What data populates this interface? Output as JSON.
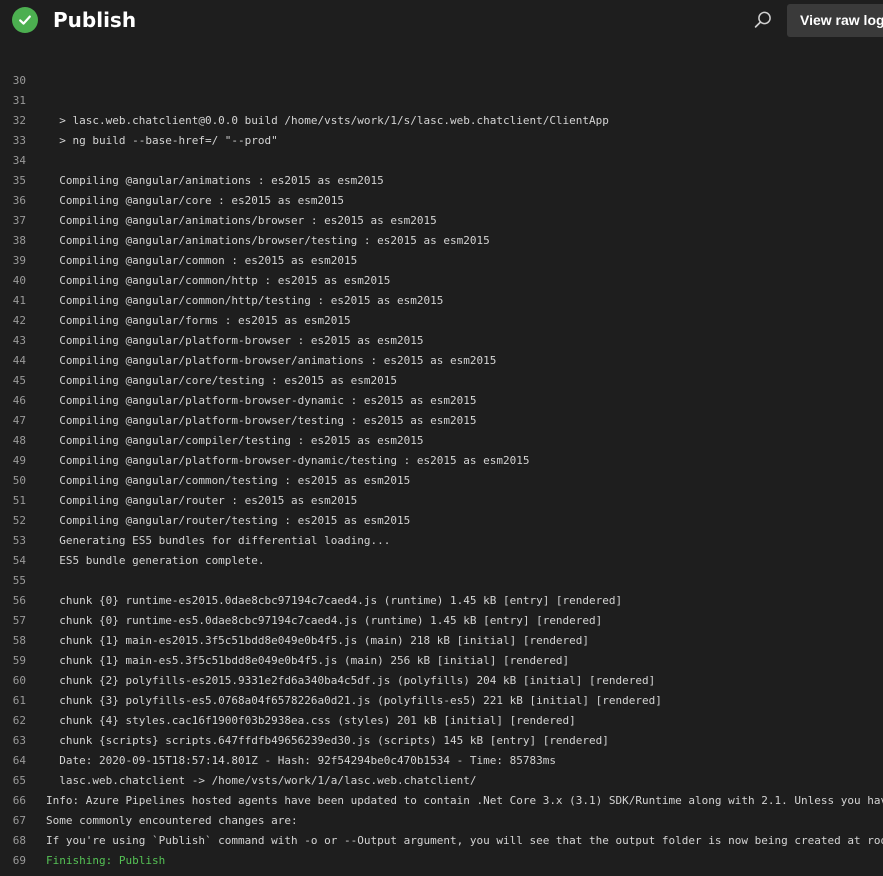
{
  "header": {
    "title": "Publish",
    "status_icon": "success-check-icon",
    "status_color": "#4caf50",
    "search_icon": "search-icon",
    "view_raw_log_label": "View raw log"
  },
  "log": {
    "lines": [
      {
        "number": "30",
        "text": ""
      },
      {
        "number": "31",
        "text": ""
      },
      {
        "number": "32",
        "text": "  > lasc.web.chatclient@0.0.0 build /home/vsts/work/1/s/lasc.web.chatclient/ClientApp"
      },
      {
        "number": "33",
        "text": "  > ng build --base-href=/ \"--prod\""
      },
      {
        "number": "34",
        "text": ""
      },
      {
        "number": "35",
        "text": "  Compiling @angular/animations : es2015 as esm2015"
      },
      {
        "number": "36",
        "text": "  Compiling @angular/core : es2015 as esm2015"
      },
      {
        "number": "37",
        "text": "  Compiling @angular/animations/browser : es2015 as esm2015"
      },
      {
        "number": "38",
        "text": "  Compiling @angular/animations/browser/testing : es2015 as esm2015"
      },
      {
        "number": "39",
        "text": "  Compiling @angular/common : es2015 as esm2015"
      },
      {
        "number": "40",
        "text": "  Compiling @angular/common/http : es2015 as esm2015"
      },
      {
        "number": "41",
        "text": "  Compiling @angular/common/http/testing : es2015 as esm2015"
      },
      {
        "number": "42",
        "text": "  Compiling @angular/forms : es2015 as esm2015"
      },
      {
        "number": "43",
        "text": "  Compiling @angular/platform-browser : es2015 as esm2015"
      },
      {
        "number": "44",
        "text": "  Compiling @angular/platform-browser/animations : es2015 as esm2015"
      },
      {
        "number": "45",
        "text": "  Compiling @angular/core/testing : es2015 as esm2015"
      },
      {
        "number": "46",
        "text": "  Compiling @angular/platform-browser-dynamic : es2015 as esm2015"
      },
      {
        "number": "47",
        "text": "  Compiling @angular/platform-browser/testing : es2015 as esm2015"
      },
      {
        "number": "48",
        "text": "  Compiling @angular/compiler/testing : es2015 as esm2015"
      },
      {
        "number": "49",
        "text": "  Compiling @angular/platform-browser-dynamic/testing : es2015 as esm2015"
      },
      {
        "number": "50",
        "text": "  Compiling @angular/common/testing : es2015 as esm2015"
      },
      {
        "number": "51",
        "text": "  Compiling @angular/router : es2015 as esm2015"
      },
      {
        "number": "52",
        "text": "  Compiling @angular/router/testing : es2015 as esm2015"
      },
      {
        "number": "53",
        "text": "  Generating ES5 bundles for differential loading..."
      },
      {
        "number": "54",
        "text": "  ES5 bundle generation complete."
      },
      {
        "number": "55",
        "text": ""
      },
      {
        "number": "56",
        "text": "  chunk {0} runtime-es2015.0dae8cbc97194c7caed4.js (runtime) 1.45 kB [entry] [rendered]"
      },
      {
        "number": "57",
        "text": "  chunk {0} runtime-es5.0dae8cbc97194c7caed4.js (runtime) 1.45 kB [entry] [rendered]"
      },
      {
        "number": "58",
        "text": "  chunk {1} main-es2015.3f5c51bdd8e049e0b4f5.js (main) 218 kB [initial] [rendered]"
      },
      {
        "number": "59",
        "text": "  chunk {1} main-es5.3f5c51bdd8e049e0b4f5.js (main) 256 kB [initial] [rendered]"
      },
      {
        "number": "60",
        "text": "  chunk {2} polyfills-es2015.9331e2fd6a340ba4c5df.js (polyfills) 204 kB [initial] [rendered]"
      },
      {
        "number": "61",
        "text": "  chunk {3} polyfills-es5.0768a04f6578226a0d21.js (polyfills-es5) 221 kB [initial] [rendered]"
      },
      {
        "number": "62",
        "text": "  chunk {4} styles.cac16f1900f03b2938ea.css (styles) 201 kB [initial] [rendered]"
      },
      {
        "number": "63",
        "text": "  chunk {scripts} scripts.647ffdfb49656239ed30.js (scripts) 145 kB [entry] [rendered]"
      },
      {
        "number": "64",
        "text": "  Date: 2020-09-15T18:57:14.801Z - Hash: 92f54294be0c470b1534 - Time: 85783ms"
      },
      {
        "number": "65",
        "text": "  lasc.web.chatclient -> /home/vsts/work/1/a/lasc.web.chatclient/"
      },
      {
        "number": "66",
        "text": "Info: Azure Pipelines hosted agents have been updated to contain .Net Core 3.x (3.1) SDK/Runtime along with 2.1. Unless you hav"
      },
      {
        "number": "67",
        "text": "Some commonly encountered changes are:"
      },
      {
        "number": "68",
        "text": "If you're using `Publish` command with -o or --Output argument, you will see that the output folder is now being created at roo"
      },
      {
        "number": "69",
        "text": "Finishing: Publish",
        "status": "success"
      }
    ]
  }
}
